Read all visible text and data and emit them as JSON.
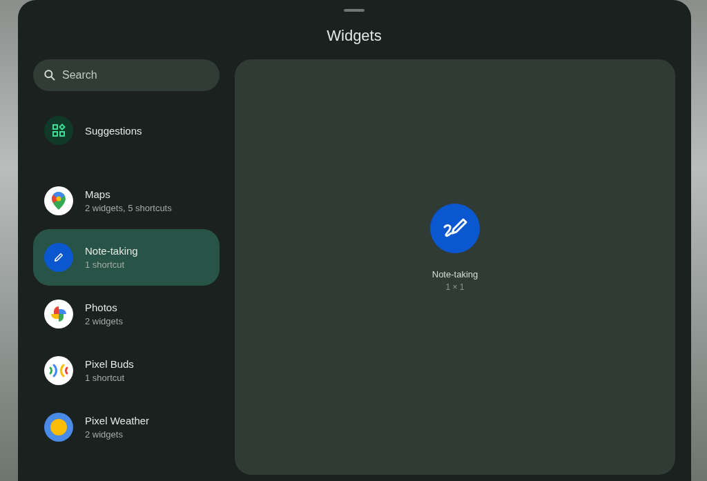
{
  "sheet": {
    "title": "Widgets"
  },
  "search": {
    "placeholder": "Search"
  },
  "categories": [
    {
      "kind": "suggestions",
      "name": "Suggestions",
      "selected": false
    },
    {
      "kind": "maps",
      "name": "Maps",
      "subtitle": "2 widgets, 5 shortcuts",
      "selected": false
    },
    {
      "kind": "note",
      "name": "Note-taking",
      "subtitle": "1 shortcut",
      "selected": true
    },
    {
      "kind": "photos",
      "name": "Photos",
      "subtitle": "2 widgets",
      "selected": false
    },
    {
      "kind": "buds",
      "name": "Pixel Buds",
      "subtitle": "1 shortcut",
      "selected": false
    },
    {
      "kind": "weather",
      "name": "Pixel Weather",
      "subtitle": "2 widgets",
      "selected": false
    }
  ],
  "preview": {
    "name": "Note-taking",
    "size": "1 × 1"
  }
}
